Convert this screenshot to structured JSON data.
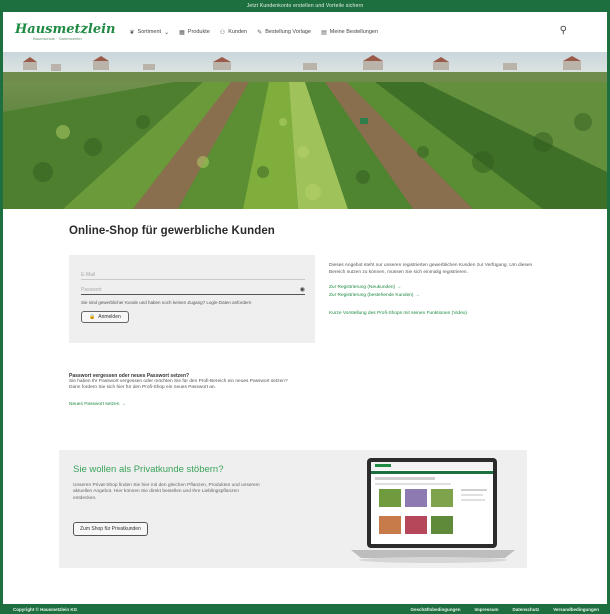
{
  "topbar": {
    "notice": "Jetzt Kundenkonto erstellen und Vorteile sichern"
  },
  "logo": {
    "word": "Hausmetzlein",
    "tagline": "Baumschule · Gartencenter"
  },
  "nav": {
    "items": [
      {
        "label": "Sortiment",
        "icon": "leaf-icon",
        "glyph": "❦",
        "caret": "⌄"
      },
      {
        "label": "Produkte",
        "icon": "grid-icon",
        "glyph": "▦",
        "caret": ""
      },
      {
        "label": "Kunden",
        "icon": "users-icon",
        "glyph": "⚇",
        "caret": ""
      },
      {
        "label": "Bestellung Vorlage",
        "icon": "tag-icon",
        "glyph": "✎",
        "caret": ""
      },
      {
        "label": "Meine Bestellungen",
        "icon": "cart-icon",
        "glyph": "▤",
        "caret": ""
      }
    ],
    "user_icon": "⚲"
  },
  "page": {
    "title": "Online-Shop für gewerbliche Kunden"
  },
  "login": {
    "email_placeholder": "E-Mail",
    "password_placeholder": "Passwort",
    "forgot_text": "Sie sind gewerblicher Kunde und haben noch keinen Zugang? Login-Daten anfordern",
    "button_label": "Anmelden",
    "button_icon": "🔒"
  },
  "info": {
    "text": "Dieses Angebot steht nur unseren registrierten gewerblichen Kunden zur Verfügung. Um diesen Bereich nutzen zu können, müssen Sie sich einmalig registrieren.",
    "link_new": "Zur Registrierung (Neukunden) →",
    "link_existing": "Zur Registrierung (bestehende Kunden) →",
    "link_video": "Kurze Vorstellung des Profi-Shops mit seinen Funktionen (Video)"
  },
  "password": {
    "heading": "Passwort vergessen oder neues Passwort setzen?",
    "line1": "Sie haben Ihr Passwort vergessen oder möchten Sie für den Profi-Bereich ein neues Passwort setzen?",
    "line2": "Dann fordern Sie sich hier für den Profi-Shop ein neues Passwort an.",
    "link": "Neues Passwort setzen →"
  },
  "private": {
    "heading": "Sie wollen als Privatkunde stöbern?",
    "text": "Unseren Privat-Shop finden Sie hier mit den gleichen Pflanzen, Produkten und unserem aktuellen Angebot. Hier können Sie direkt bestellen und Ihre Lieblingspflanzen entdecken.",
    "button_label": "Zum Shop für Privatkunden"
  },
  "footer": {
    "copyright": "Copyright © Hausmetzlein KG",
    "links": [
      "Geschäftsbedingungen",
      "Impressum",
      "Datenschutz",
      "Versandbedingungen"
    ]
  },
  "colors": {
    "brand": "#1e6f3f",
    "link": "#1f8a43",
    "accent_green": "#3aa35b"
  }
}
